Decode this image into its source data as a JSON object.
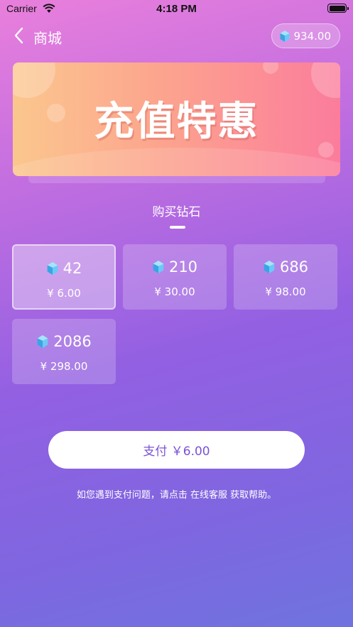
{
  "status_bar": {
    "carrier": "Carrier",
    "time": "4:18 PM"
  },
  "nav": {
    "title": "商城",
    "balance": "934.00",
    "back_icon": "chevron-left-icon",
    "gem_icon": "diamond-icon"
  },
  "banner": {
    "text": "充值特惠"
  },
  "section": {
    "title": "购买钻石"
  },
  "packages": [
    {
      "amount": "42",
      "price": "¥ 6.00",
      "selected": true
    },
    {
      "amount": "210",
      "price": "¥ 30.00",
      "selected": false
    },
    {
      "amount": "686",
      "price": "¥ 98.00",
      "selected": false
    },
    {
      "amount": "2086",
      "price": "¥ 298.00",
      "selected": false
    }
  ],
  "pay_button": {
    "label": "支付 ￥6.00"
  },
  "help": {
    "text": "如您遇到支付问题，请点击 在线客服 获取帮助。"
  },
  "colors": {
    "accent": "#7a52d6",
    "gem": "#4fb8f0"
  }
}
